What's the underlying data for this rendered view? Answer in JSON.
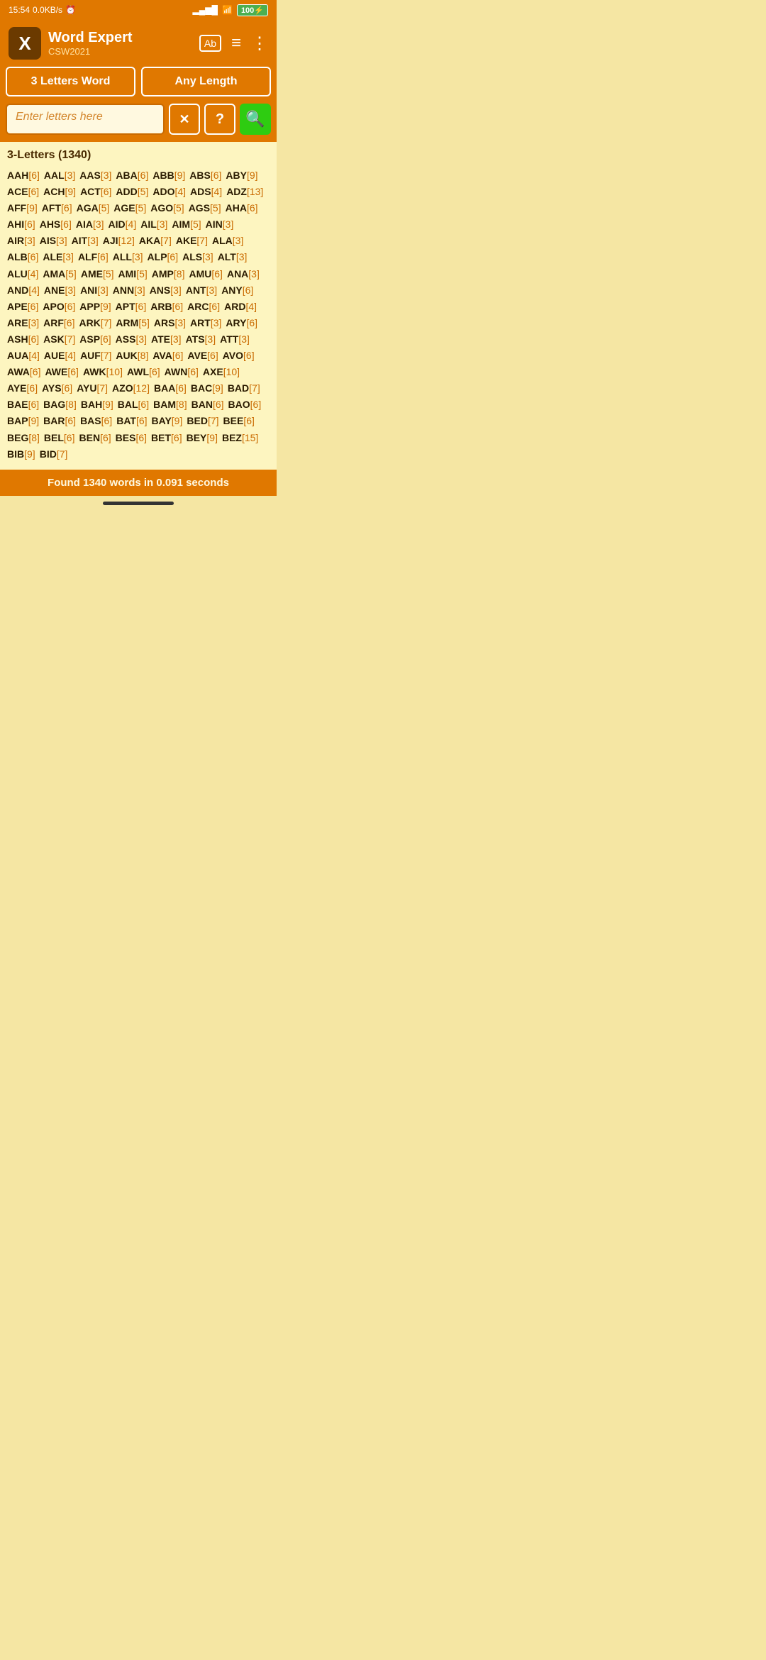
{
  "statusBar": {
    "time": "15:54",
    "network": "0.0KB/s",
    "alarm": "⏰",
    "signal": "📶",
    "wifi": "📡",
    "battery": "100",
    "bolt": "⚡"
  },
  "header": {
    "logoText": "X",
    "appName": "Word Expert",
    "subtitle": "CSW2021",
    "icons": {
      "book": "Ab",
      "filter": "≡",
      "menu": "⋮"
    }
  },
  "toolbar": {
    "leftButton": "3 Letters Word",
    "rightButton": "Any Length"
  },
  "search": {
    "placeholder": "Enter letters here",
    "clearLabel": "✕",
    "helpLabel": "?",
    "searchLabel": "🔍"
  },
  "wordList": {
    "title": "3-Letters (1340)",
    "words": [
      {
        "w": "AAH",
        "s": "[6]"
      },
      {
        "w": "AAL",
        "s": "[3]"
      },
      {
        "w": "AAS",
        "s": "[3]"
      },
      {
        "w": "ABA",
        "s": "[6]"
      },
      {
        "w": "ABB",
        "s": "[9]"
      },
      {
        "w": "ABS",
        "s": "[6]"
      },
      {
        "w": "ABY",
        "s": "[9]"
      },
      {
        "w": "ACE",
        "s": "[6]"
      },
      {
        "w": "ACH",
        "s": "[9]"
      },
      {
        "w": "ACT",
        "s": "[6]"
      },
      {
        "w": "ADD",
        "s": "[5]"
      },
      {
        "w": "ADO",
        "s": "[4]"
      },
      {
        "w": "ADS",
        "s": "[4]"
      },
      {
        "w": "ADZ",
        "s": "[13]"
      },
      {
        "w": "AFF",
        "s": "[9]"
      },
      {
        "w": "AFT",
        "s": "[6]"
      },
      {
        "w": "AGA",
        "s": "[5]"
      },
      {
        "w": "AGE",
        "s": "[5]"
      },
      {
        "w": "AGO",
        "s": "[5]"
      },
      {
        "w": "AGS",
        "s": "[5]"
      },
      {
        "w": "AHA",
        "s": "[6]"
      },
      {
        "w": "AHI",
        "s": "[6]"
      },
      {
        "w": "AHS",
        "s": "[6]"
      },
      {
        "w": "AIA",
        "s": "[3]"
      },
      {
        "w": "AID",
        "s": "[4]"
      },
      {
        "w": "AIL",
        "s": "[3]"
      },
      {
        "w": "AIM",
        "s": "[5]"
      },
      {
        "w": "AIN",
        "s": "[3]"
      },
      {
        "w": "AIR",
        "s": "[3]"
      },
      {
        "w": "AIS",
        "s": "[3]"
      },
      {
        "w": "AIT",
        "s": "[3]"
      },
      {
        "w": "AJI",
        "s": "[12]"
      },
      {
        "w": "AKA",
        "s": "[7]"
      },
      {
        "w": "AKE",
        "s": "[7]"
      },
      {
        "w": "ALA",
        "s": "[3]"
      },
      {
        "w": "ALB",
        "s": "[6]"
      },
      {
        "w": "ALE",
        "s": "[3]"
      },
      {
        "w": "ALF",
        "s": "[6]"
      },
      {
        "w": "ALL",
        "s": "[3]"
      },
      {
        "w": "ALP",
        "s": "[6]"
      },
      {
        "w": "ALS",
        "s": "[3]"
      },
      {
        "w": "ALT",
        "s": "[3]"
      },
      {
        "w": "ALU",
        "s": "[4]"
      },
      {
        "w": "AMA",
        "s": "[5]"
      },
      {
        "w": "AME",
        "s": "[5]"
      },
      {
        "w": "AMI",
        "s": "[5]"
      },
      {
        "w": "AMP",
        "s": "[8]"
      },
      {
        "w": "AMU",
        "s": "[6]"
      },
      {
        "w": "ANA",
        "s": "[3]"
      },
      {
        "w": "AND",
        "s": "[4]"
      },
      {
        "w": "ANE",
        "s": "[3]"
      },
      {
        "w": "ANI",
        "s": "[3]"
      },
      {
        "w": "ANN",
        "s": "[3]"
      },
      {
        "w": "ANS",
        "s": "[3]"
      },
      {
        "w": "ANT",
        "s": "[3]"
      },
      {
        "w": "ANY",
        "s": "[6]"
      },
      {
        "w": "APE",
        "s": "[6]"
      },
      {
        "w": "APO",
        "s": "[6]"
      },
      {
        "w": "APP",
        "s": "[9]"
      },
      {
        "w": "APT",
        "s": "[6]"
      },
      {
        "w": "ARB",
        "s": "[6]"
      },
      {
        "w": "ARC",
        "s": "[6]"
      },
      {
        "w": "ARD",
        "s": "[4]"
      },
      {
        "w": "ARE",
        "s": "[3]"
      },
      {
        "w": "ARF",
        "s": "[6]"
      },
      {
        "w": "ARK",
        "s": "[7]"
      },
      {
        "w": "ARM",
        "s": "[5]"
      },
      {
        "w": "ARS",
        "s": "[3]"
      },
      {
        "w": "ART",
        "s": "[3]"
      },
      {
        "w": "ARY",
        "s": "[6]"
      },
      {
        "w": "ASH",
        "s": "[6]"
      },
      {
        "w": "ASK",
        "s": "[7]"
      },
      {
        "w": "ASP",
        "s": "[6]"
      },
      {
        "w": "ASS",
        "s": "[3]"
      },
      {
        "w": "ATE",
        "s": "[3]"
      },
      {
        "w": "ATS",
        "s": "[3]"
      },
      {
        "w": "ATT",
        "s": "[3]"
      },
      {
        "w": "AUA",
        "s": "[4]"
      },
      {
        "w": "AUE",
        "s": "[4]"
      },
      {
        "w": "AUF",
        "s": "[7]"
      },
      {
        "w": "AUK",
        "s": "[8]"
      },
      {
        "w": "AVA",
        "s": "[6]"
      },
      {
        "w": "AVE",
        "s": "[6]"
      },
      {
        "w": "AVO",
        "s": "[6]"
      },
      {
        "w": "AWA",
        "s": "[6]"
      },
      {
        "w": "AWE",
        "s": "[6]"
      },
      {
        "w": "AWK",
        "s": "[10]"
      },
      {
        "w": "AWL",
        "s": "[6]"
      },
      {
        "w": "AWN",
        "s": "[6]"
      },
      {
        "w": "AXE",
        "s": "[10]"
      },
      {
        "w": "AYE",
        "s": "[6]"
      },
      {
        "w": "AYS",
        "s": "[6]"
      },
      {
        "w": "AYU",
        "s": "[7]"
      },
      {
        "w": "AZO",
        "s": "[12]"
      },
      {
        "w": "BAA",
        "s": "[6]"
      },
      {
        "w": "BAC",
        "s": "[9]"
      },
      {
        "w": "BAD",
        "s": "[7]"
      },
      {
        "w": "BAE",
        "s": "[6]"
      },
      {
        "w": "BAG",
        "s": "[8]"
      },
      {
        "w": "BAH",
        "s": "[9]"
      },
      {
        "w": "BAL",
        "s": "[6]"
      },
      {
        "w": "BAM",
        "s": "[8]"
      },
      {
        "w": "BAN",
        "s": "[6]"
      },
      {
        "w": "BAO",
        "s": "[6]"
      },
      {
        "w": "BAP",
        "s": "[9]"
      },
      {
        "w": "BAR",
        "s": "[6]"
      },
      {
        "w": "BAS",
        "s": "[6]"
      },
      {
        "w": "BAT",
        "s": "[6]"
      },
      {
        "w": "BAY",
        "s": "[9]"
      },
      {
        "w": "BED",
        "s": "[7]"
      },
      {
        "w": "BEE",
        "s": "[6]"
      },
      {
        "w": "BEG",
        "s": "[8]"
      },
      {
        "w": "BEL",
        "s": "[6]"
      },
      {
        "w": "BEN",
        "s": "[6]"
      },
      {
        "w": "BES",
        "s": "[6]"
      },
      {
        "w": "BET",
        "s": "[6]"
      },
      {
        "w": "BEY",
        "s": "[9]"
      },
      {
        "w": "BEZ",
        "s": "[15]"
      },
      {
        "w": "BIB",
        "s": "[9]"
      },
      {
        "w": "BID",
        "s": "[7]"
      }
    ]
  },
  "footer": {
    "text": "Found 1340 words in 0.091 seconds"
  }
}
